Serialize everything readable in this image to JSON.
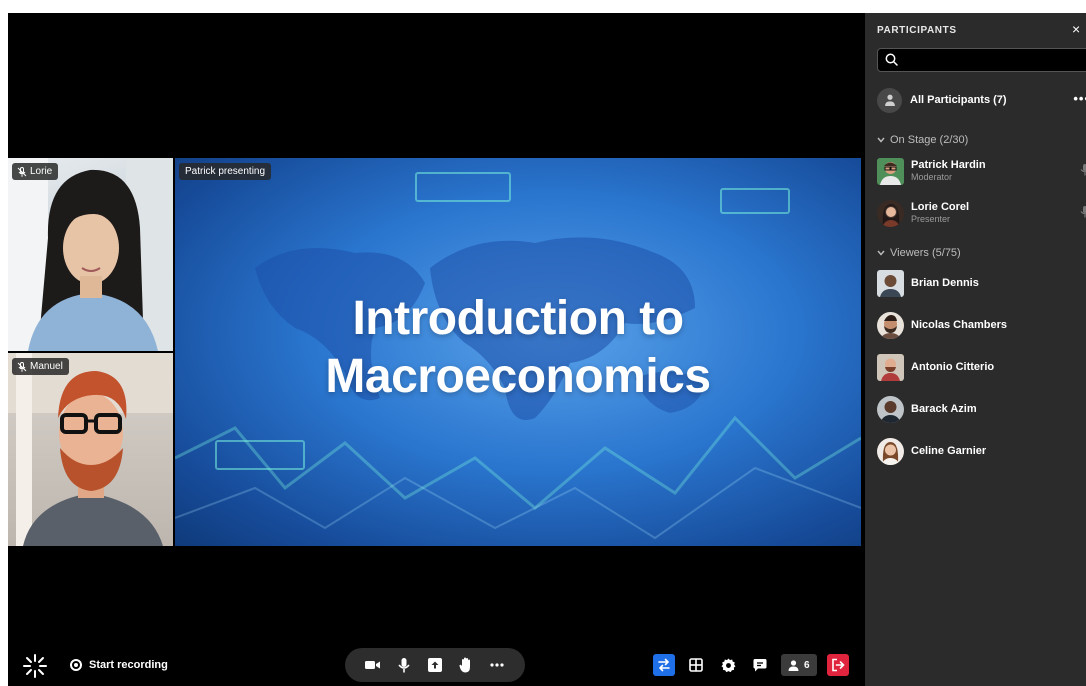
{
  "tiles": {
    "lorie": {
      "label": "Lorie"
    },
    "manuel": {
      "label": "Manuel"
    }
  },
  "stage": {
    "tag": "Patrick presenting",
    "title": "Introduction to\nMacroeconomics"
  },
  "bottom_bar": {
    "start_recording": "Start recording",
    "participants_count": "6"
  },
  "panel": {
    "title": "PARTICIPANTS",
    "close": "×",
    "search_placeholder": "",
    "all_participants": "All Participants (7)",
    "more": "•••",
    "on_stage_header": "On Stage (2/30)",
    "on_stage": [
      {
        "name": "Patrick Hardin",
        "role": "Moderator"
      },
      {
        "name": "Lorie Corel",
        "role": "Presenter"
      }
    ],
    "viewers_header": "Viewers (5/75)",
    "viewers": [
      {
        "name": "Brian Dennis"
      },
      {
        "name": "Nicolas Chambers"
      },
      {
        "name": "Antonio Citterio"
      },
      {
        "name": "Barack Azim"
      },
      {
        "name": "Celine Garnier"
      }
    ]
  },
  "colors": {
    "panel_bg": "#2b2b2b",
    "accent_blue": "#1e6fe8",
    "leave_red": "#e0243d"
  },
  "icons": [
    "mic-off-icon",
    "brand-icon",
    "record-icon",
    "camera-icon",
    "mic-icon",
    "share-screen-icon",
    "raise-hand-icon",
    "more-icon",
    "switch-icon",
    "grid-icon",
    "settings-icon",
    "chat-icon",
    "person-icon",
    "leave-icon",
    "search-icon",
    "chevron-down-icon",
    "close-icon"
  ]
}
